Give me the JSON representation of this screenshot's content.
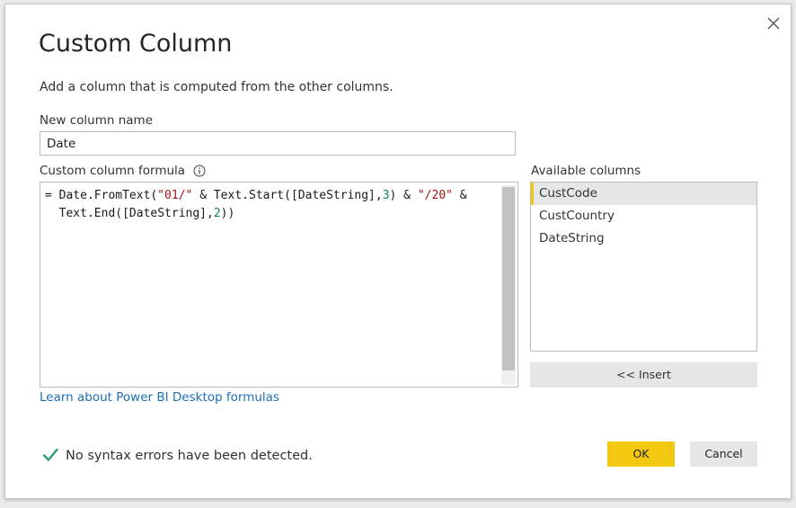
{
  "dialog": {
    "title": "Custom Column",
    "subtitle": "Add a column that is computed from the other columns."
  },
  "new_column": {
    "label": "New column name",
    "value": "Date"
  },
  "formula": {
    "label": "Custom column formula",
    "line1": {
      "p1": "= Date.FromText(",
      "s1": "\"01/\"",
      "p2": " & Text.Start([DateString],",
      "n1": "3",
      "p3": ") & ",
      "s2": "\"/20\"",
      "p4": " &"
    },
    "line2": {
      "p1": "  Text.End([DateString],",
      "n1": "2",
      "p2": "))"
    }
  },
  "available_columns": {
    "label": "Available columns",
    "items": [
      "CustCode",
      "CustCountry",
      "DateString"
    ],
    "selected": "CustCode"
  },
  "insert_label": "<< Insert",
  "learn_link": "Learn about Power BI Desktop formulas",
  "status": "No syntax errors have been detected.",
  "buttons": {
    "ok": "OK",
    "cancel": "Cancel"
  },
  "colors": {
    "accent": "#f2c811",
    "link": "#1e6fb7",
    "check": "#2e9e6c",
    "string": "#a31515",
    "number": "#098658"
  },
  "icons": {
    "close": "close-icon",
    "info": "info-icon",
    "check": "checkmark-icon"
  }
}
